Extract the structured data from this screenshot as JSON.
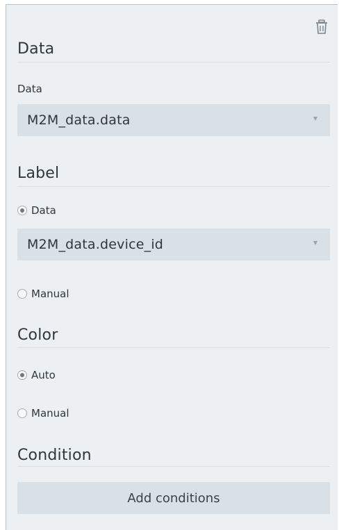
{
  "data_section": {
    "title": "Data",
    "field_label": "Data",
    "select_value": "M2M_data.data"
  },
  "label_section": {
    "title": "Label",
    "options": [
      {
        "label": "Data",
        "checked": true
      },
      {
        "label": "Manual",
        "checked": false
      }
    ],
    "select_value": "M2M_data.device_id"
  },
  "color_section": {
    "title": "Color",
    "options": [
      {
        "label": "Auto",
        "checked": true
      },
      {
        "label": "Manual",
        "checked": false
      }
    ]
  },
  "condition_section": {
    "title": "Condition",
    "button_label": "Add conditions"
  },
  "icons": {
    "delete": "trash-icon",
    "dropdown": "caret-down-icon"
  },
  "colors": {
    "panel_bg": "#edf0f3",
    "select_bg": "#d9e0e6",
    "text": "#2f363c"
  }
}
